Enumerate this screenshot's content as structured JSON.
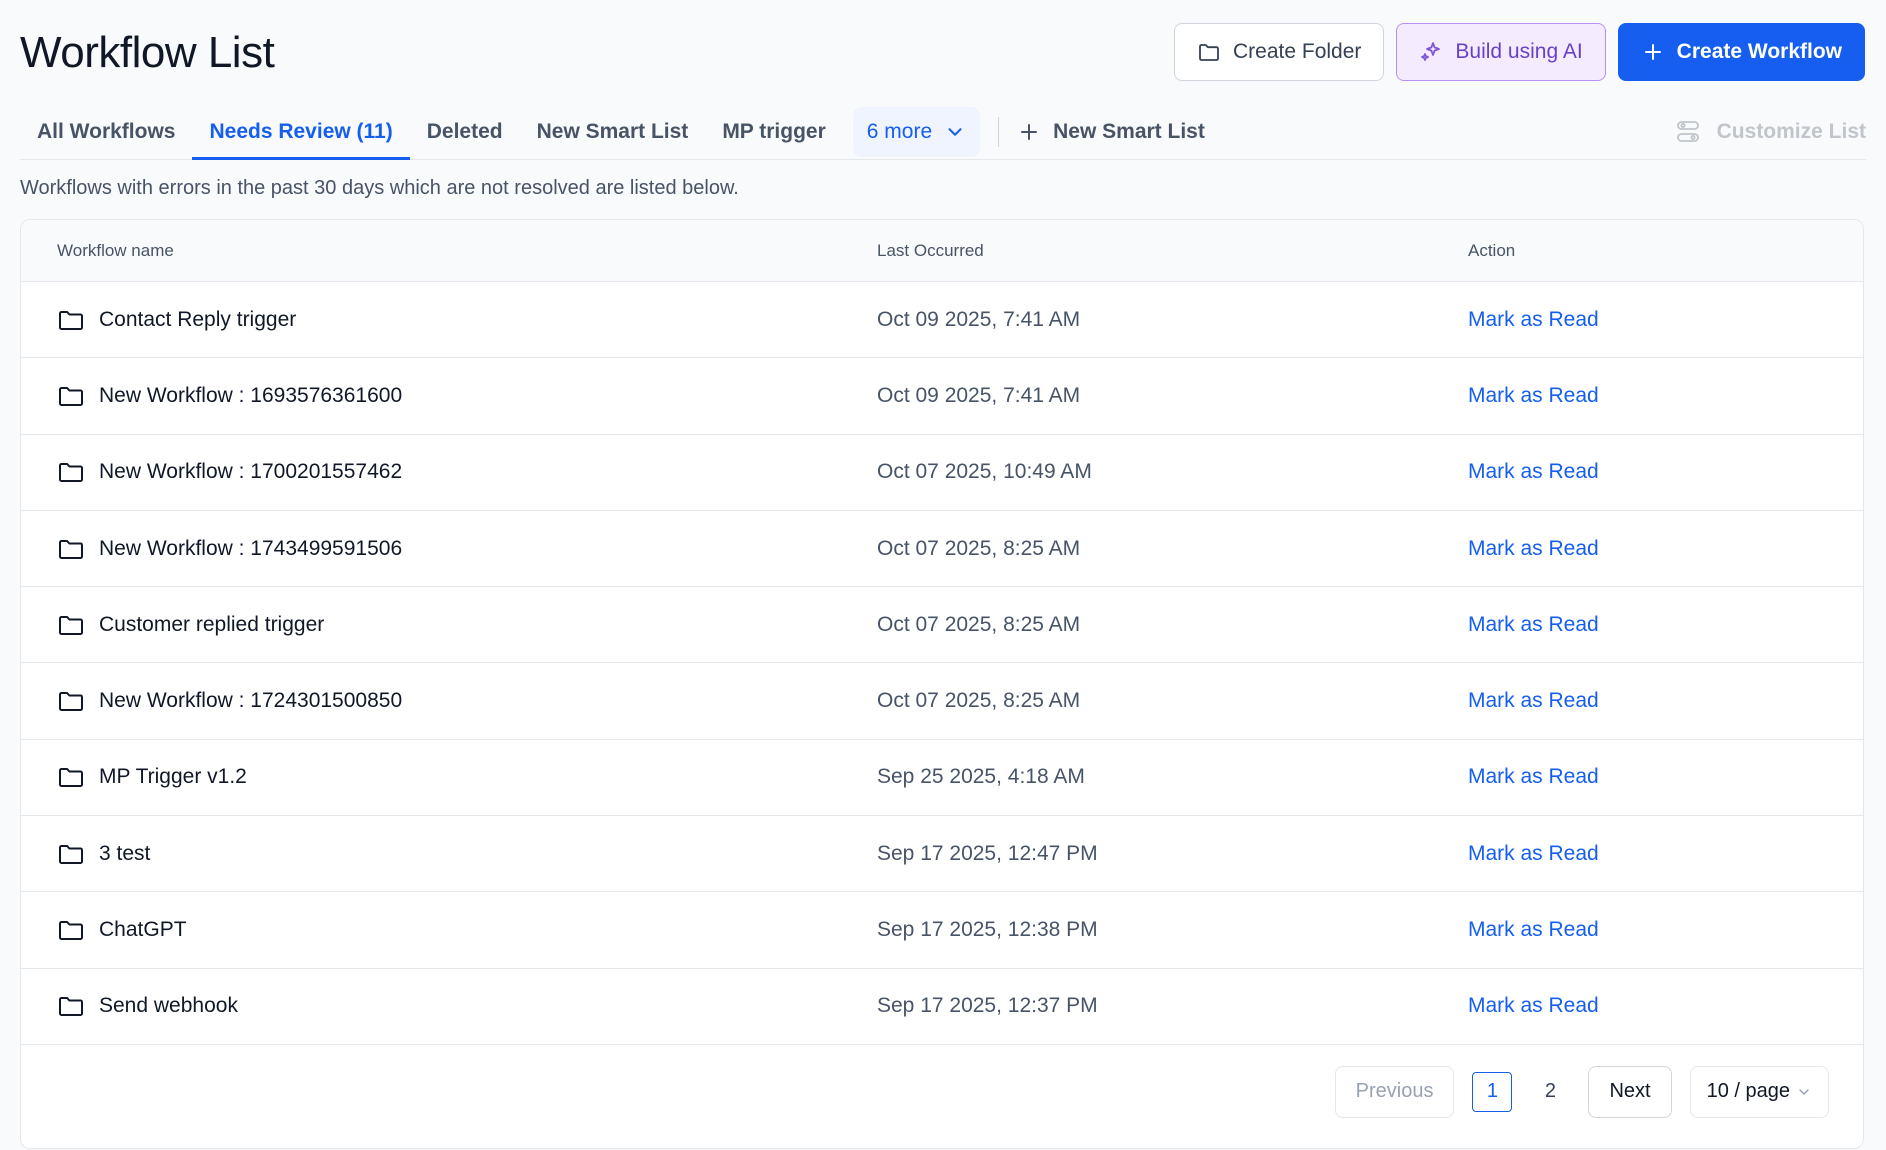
{
  "header": {
    "title": "Workflow List",
    "create_folder_label": "Create Folder",
    "build_ai_label": "Build using AI",
    "create_workflow_label": "Create Workflow"
  },
  "tabs": {
    "items": [
      {
        "label": "All Workflows",
        "active": false
      },
      {
        "label": "Needs Review (11)",
        "active": true
      },
      {
        "label": "Deleted",
        "active": false
      },
      {
        "label": "New Smart List",
        "active": false
      },
      {
        "label": "MP trigger",
        "active": false
      }
    ],
    "more_label": "6 more",
    "new_smart_list_label": "New Smart List",
    "customize_label": "Customize List"
  },
  "subtitle": "Workflows with errors in the past 30 days which are not resolved are listed below.",
  "table": {
    "columns": {
      "name": "Workflow name",
      "date": "Last Occurred",
      "action": "Action"
    },
    "rows": [
      {
        "name": "Contact Reply trigger",
        "date": "Oct 09 2025, 7:41 AM",
        "action": "Mark as Read"
      },
      {
        "name": "New Workflow : 1693576361600",
        "date": "Oct 09 2025, 7:41 AM",
        "action": "Mark as Read"
      },
      {
        "name": "New Workflow : 1700201557462",
        "date": "Oct 07 2025, 10:49 AM",
        "action": "Mark as Read"
      },
      {
        "name": "New Workflow : 1743499591506",
        "date": "Oct 07 2025, 8:25 AM",
        "action": "Mark as Read"
      },
      {
        "name": "Customer replied trigger",
        "date": "Oct 07 2025, 8:25 AM",
        "action": "Mark as Read"
      },
      {
        "name": "New Workflow : 1724301500850",
        "date": "Oct 07 2025, 8:25 AM",
        "action": "Mark as Read"
      },
      {
        "name": "MP Trigger v1.2",
        "date": "Sep 25 2025, 4:18 AM",
        "action": "Mark as Read"
      },
      {
        "name": "3 test",
        "date": "Sep 17 2025, 12:47 PM",
        "action": "Mark as Read"
      },
      {
        "name": "ChatGPT",
        "date": "Sep 17 2025, 12:38 PM",
        "action": "Mark as Read"
      },
      {
        "name": "Send webhook",
        "date": "Sep 17 2025, 12:37 PM",
        "action": "Mark as Read"
      }
    ]
  },
  "pagination": {
    "previous_label": "Previous",
    "pages": [
      "1",
      "2"
    ],
    "current_page": "1",
    "next_label": "Next",
    "page_size_label": "10 / page"
  },
  "colors": {
    "primary": "#155eef",
    "ai_accent": "#6941c6",
    "background": "#f9fafb"
  },
  "icons": [
    "folder-icon",
    "sparkle-icon",
    "plus-icon",
    "chevron-down-icon",
    "customize-icon"
  ]
}
